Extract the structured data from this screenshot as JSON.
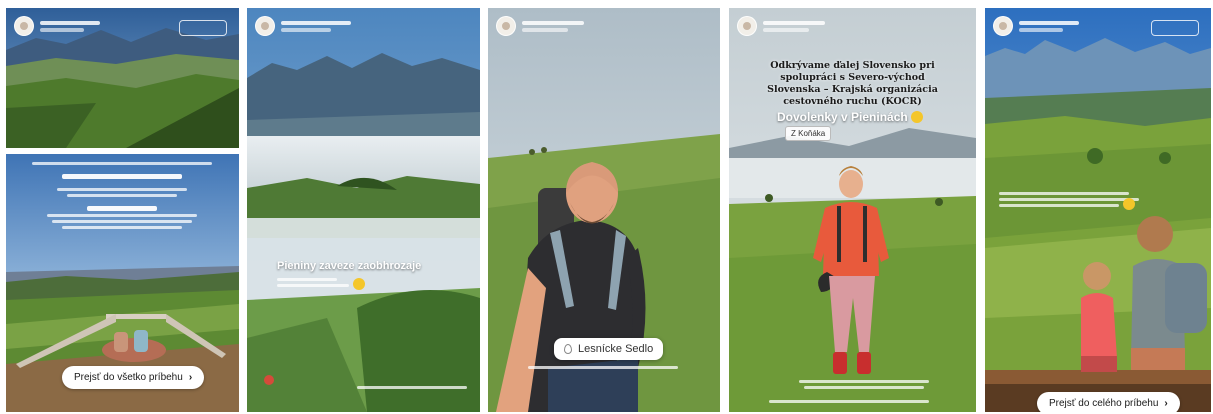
{
  "stories": [
    {
      "id": "story-1",
      "button": {
        "label": "Prejsť do všetko príbehu",
        "arrow": "›"
      }
    },
    {
      "id": "story-2",
      "title": "Pieniny zaveze zaobhrozaje"
    },
    {
      "id": "story-3",
      "location": "Lesnícke Sedlo"
    },
    {
      "id": "story-4",
      "title": "Odkrývame ďalej Slovensko pri\nspolupráci s Severo-východ\nSlovenska – Krajská organizácia\ncestovného ruchu (KOCR)",
      "subtitle": "Dovolenky v Pieninách",
      "tag": "Z Koňáka"
    },
    {
      "id": "story-5",
      "button": {
        "label": "Prejsť do celého príbehu",
        "arrow": "›"
      }
    }
  ],
  "icons": {
    "location": "map-pin-icon",
    "arrow": "chevron-right-icon",
    "sun": "sun-emoji-icon"
  },
  "colors": {
    "sky_blue": "#5b8fc8",
    "meadow_green": "#6f9a3e",
    "jacket_red": "#e85a3c",
    "sun_yellow": "#f4c62a"
  }
}
